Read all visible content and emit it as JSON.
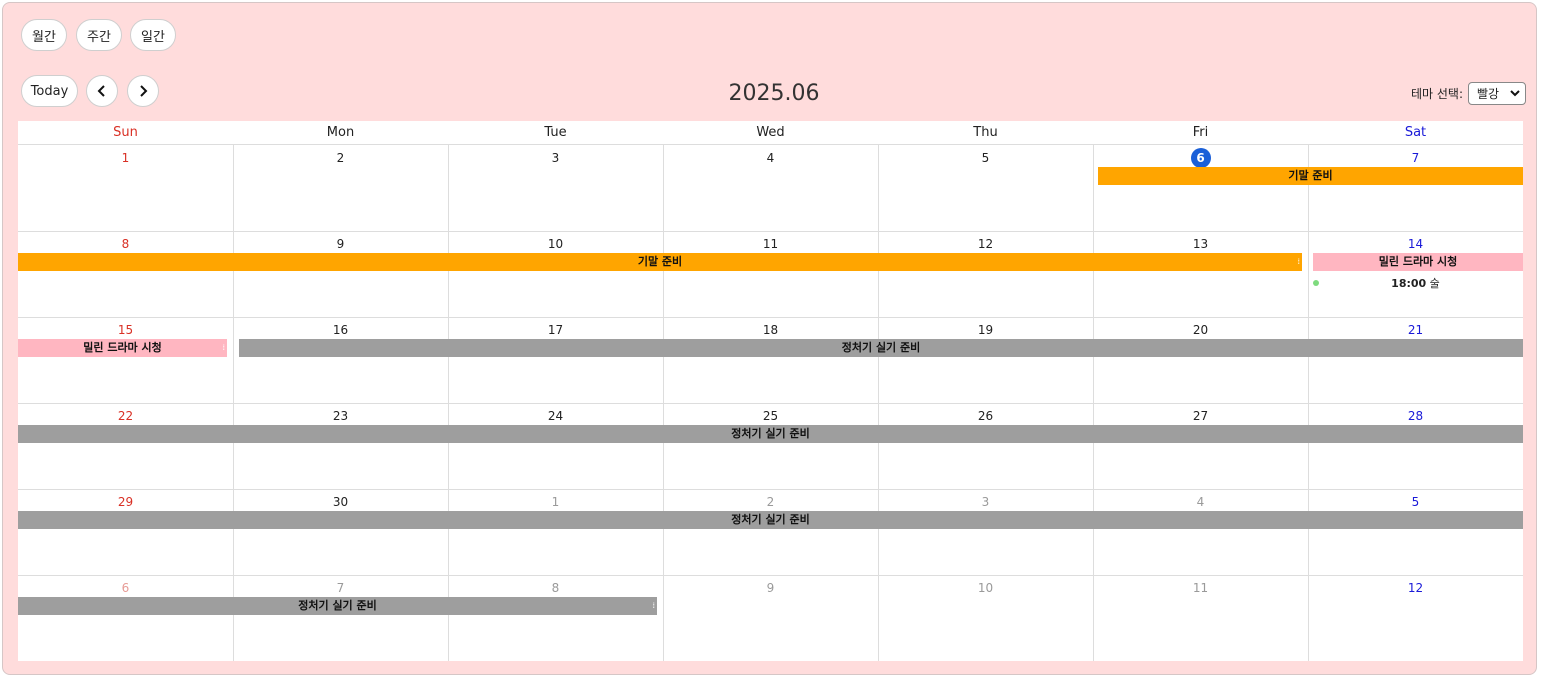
{
  "view_buttons": [
    {
      "label": "월간"
    },
    {
      "label": "주간"
    },
    {
      "label": "일간"
    }
  ],
  "nav": {
    "today_label": "Today",
    "prev_icon": "chevron-left-icon",
    "next_icon": "chevron-right-icon"
  },
  "title": "2025.06",
  "theme": {
    "label": "테마 선택:",
    "selected": "빨강"
  },
  "weekdays": [
    "Sun",
    "Mon",
    "Tue",
    "Wed",
    "Thu",
    "Fri",
    "Sat"
  ],
  "colors": {
    "background": "#ffdcdc",
    "sunday": "#d93025",
    "saturday": "#1a1ad8",
    "today": "#1a5fd8",
    "exam_prep": "#ffa500",
    "drama": "#ffb6c1",
    "engineer_prep": "#9e9e9e",
    "dot": "#7edb7e"
  },
  "weeks": [
    {
      "days": [
        {
          "d": "1"
        },
        {
          "d": "2"
        },
        {
          "d": "3"
        },
        {
          "d": "4"
        },
        {
          "d": "5"
        },
        {
          "d": "6",
          "today": true
        },
        {
          "d": "7"
        }
      ]
    },
    {
      "days": [
        {
          "d": "8"
        },
        {
          "d": "9"
        },
        {
          "d": "10"
        },
        {
          "d": "11"
        },
        {
          "d": "12"
        },
        {
          "d": "13"
        },
        {
          "d": "14"
        }
      ]
    },
    {
      "days": [
        {
          "d": "15"
        },
        {
          "d": "16"
        },
        {
          "d": "17"
        },
        {
          "d": "18"
        },
        {
          "d": "19"
        },
        {
          "d": "20"
        },
        {
          "d": "21"
        }
      ]
    },
    {
      "days": [
        {
          "d": "22"
        },
        {
          "d": "23"
        },
        {
          "d": "24"
        },
        {
          "d": "25"
        },
        {
          "d": "26"
        },
        {
          "d": "27"
        },
        {
          "d": "28"
        }
      ]
    },
    {
      "days": [
        {
          "d": "29"
        },
        {
          "d": "30"
        },
        {
          "d": "1",
          "other": true
        },
        {
          "d": "2",
          "other": true
        },
        {
          "d": "3",
          "other": true
        },
        {
          "d": "4",
          "other": true
        },
        {
          "d": "5",
          "other": true
        }
      ]
    },
    {
      "days": [
        {
          "d": "6",
          "other": true
        },
        {
          "d": "7",
          "other": true
        },
        {
          "d": "8",
          "other": true
        },
        {
          "d": "9",
          "other": true
        },
        {
          "d": "10",
          "other": true
        },
        {
          "d": "11",
          "other": true
        },
        {
          "d": "12",
          "other": true
        }
      ]
    }
  ],
  "events": {
    "exam_prep": "기말 준비",
    "drama": "밀린 드라마 시청",
    "engineer_prep": "정처기 실기 준비",
    "drink": {
      "time": "18:00",
      "title": "술"
    }
  }
}
